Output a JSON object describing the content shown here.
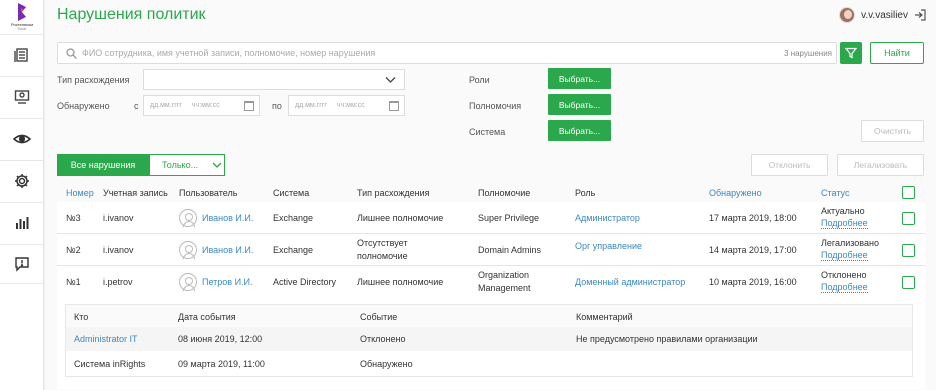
{
  "brand": {
    "logo_text": "Ростелеком",
    "logo_subtext": "Solar"
  },
  "sidebar": {
    "items": [
      {
        "icon": "documents-icon"
      },
      {
        "icon": "monitor-icon"
      },
      {
        "icon": "eye-icon"
      },
      {
        "icon": "gear-icon"
      },
      {
        "icon": "bar-chart-icon"
      },
      {
        "icon": "alert-message-icon"
      }
    ]
  },
  "header": {
    "title": "Нарушения политик",
    "username": "v.v.vasiliev"
  },
  "search": {
    "placeholder": "ФИО сотрудника, имя учетной записи, полномочие, номер нарушения",
    "count": "3 нарушения",
    "find_label": "Найти"
  },
  "filters": {
    "discrepancy_type_label": "Тип расхождения",
    "detected_label": "Обнаружено",
    "from_label": "с",
    "to_label": "по",
    "date_placeholder": "дд.мм.гггг",
    "time_placeholder": "чч:мм:сс",
    "roles_label": "Роли",
    "permissions_label": "Полномочия",
    "system_label": "Система",
    "choose_label": "Выбрать...",
    "clear_label": "Очистить"
  },
  "tabs": {
    "all_label": "Все нарушения",
    "only_label": "Только..."
  },
  "actions": {
    "reject_label": "Отклонить",
    "legalize_label": "Легализовать"
  },
  "colors": {
    "accent": "#2aa84b",
    "link": "#3c88c4"
  },
  "table": {
    "headers": {
      "number": "Номер",
      "account": "Учетная запись",
      "user": "Пользователь",
      "system": "Система",
      "type": "Тип расхождения",
      "permission": "Полномочие",
      "role": "Роль",
      "detected": "Обнаружено",
      "status": "Статус"
    },
    "rows": [
      {
        "number": "№3",
        "account": "i.ivanov",
        "user": "Иванов И.И.",
        "system": "Exchange",
        "type_1": "Лишнее полномочие",
        "type_2": "",
        "perm_1": "Super Privilege",
        "perm_2": "",
        "role": "Администратор",
        "detected": "17 марта 2019, 18:00",
        "status": "Актуально",
        "more": "Подробнее"
      },
      {
        "number": "№2",
        "account": "i.ivanov",
        "user": "Иванов И.И.",
        "system": "Exchange",
        "type_1": "Отсутствует",
        "type_2": "полномочие",
        "perm_1": "Domain Admins",
        "perm_2": "",
        "role": "Орг управление",
        "detected": "14 марта 2019, 17:00",
        "status": "Легализовано",
        "more": "Подробнее"
      },
      {
        "number": "№1",
        "account": "i.petrov",
        "user": "Петров И.И.",
        "system": "Active Directory",
        "type_1": "Лишнее полномочие",
        "type_2": "",
        "perm_1": "Organization",
        "perm_2": "Management",
        "role": "Доменный администратор",
        "detected": "10 марта 2019, 16:00",
        "status": "Отклонено",
        "more": "Подробнее"
      }
    ]
  },
  "history": {
    "headers": {
      "who": "Кто",
      "date": "Дата события",
      "event": "Событие",
      "comment": "Комментарий"
    },
    "rows": [
      {
        "who": "Administrator IT",
        "date": "08 июня 2019, 12:00",
        "event": "Отклонено",
        "comment": "Не предусмотрено правилами организации"
      },
      {
        "who": "Система inRights",
        "date": "09 марта 2019, 11:00",
        "event": "Обнаружено",
        "comment": ""
      }
    ]
  }
}
